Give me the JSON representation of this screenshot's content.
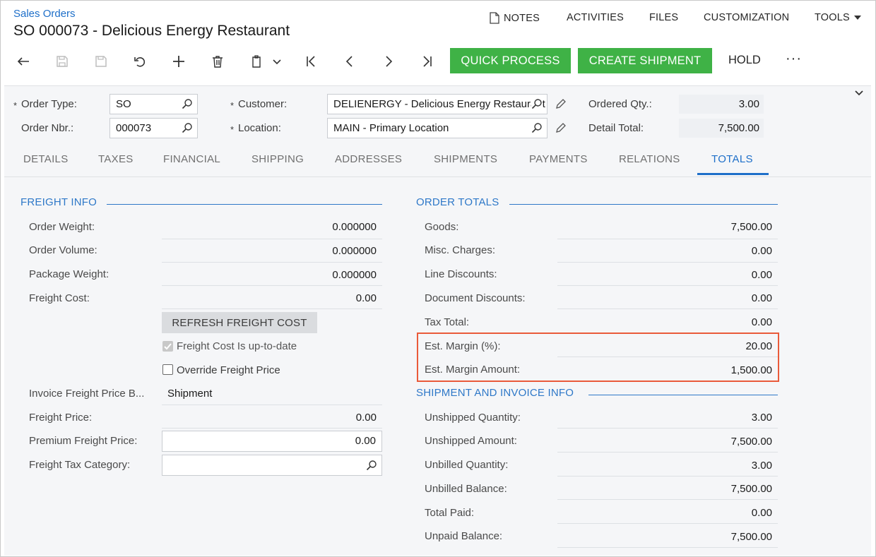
{
  "header": {
    "breadcrumb": "Sales Orders",
    "title": "SO 000073 - Delicious Energy Restaurant",
    "nav": {
      "notes": "NOTES",
      "activities": "ACTIVITIES",
      "files": "FILES",
      "customization": "CUSTOMIZATION",
      "tools": "TOOLS"
    }
  },
  "toolbar": {
    "quick_process": "QUICK PROCESS",
    "create_shipment": "CREATE SHIPMENT",
    "hold": "HOLD",
    "more": "···"
  },
  "summary": {
    "order_type_label": "Order Type:",
    "order_type": "SO",
    "order_nbr_label": "Order Nbr.:",
    "order_nbr": "000073",
    "customer_label": "Customer:",
    "customer": "DELIENERGY - Delicious Energy Restaurant",
    "location_label": "Location:",
    "location": "MAIN - Primary Location",
    "ordered_qty_label": "Ordered Qty.:",
    "ordered_qty": "3.00",
    "detail_total_label": "Detail Total:",
    "detail_total": "7,500.00",
    "required_mark": "*"
  },
  "tabs": [
    "DETAILS",
    "TAXES",
    "FINANCIAL",
    "SHIPPING",
    "ADDRESSES",
    "SHIPMENTS",
    "PAYMENTS",
    "RELATIONS",
    "TOTALS"
  ],
  "freight": {
    "title": "FREIGHT INFO",
    "order_weight_label": "Order Weight:",
    "order_weight": "0.000000",
    "order_volume_label": "Order Volume:",
    "order_volume": "0.000000",
    "package_weight_label": "Package Weight:",
    "package_weight": "0.000000",
    "freight_cost_label": "Freight Cost:",
    "freight_cost": "0.00",
    "refresh_button": "REFRESH FREIGHT COST",
    "up_to_date_label": "Freight Cost Is up-to-date",
    "override_label": "Override Freight Price",
    "invoice_basis_label": "Invoice Freight Price B...",
    "invoice_basis": "Shipment",
    "freight_price_label": "Freight Price:",
    "freight_price": "0.00",
    "premium_label": "Premium Freight Price:",
    "premium": "0.00",
    "tax_category_label": "Freight Tax Category:",
    "tax_category": ""
  },
  "totals": {
    "title": "ORDER TOTALS",
    "goods_label": "Goods:",
    "goods": "7,500.00",
    "misc_label": "Misc. Charges:",
    "misc": "0.00",
    "line_disc_label": "Line Discounts:",
    "line_disc": "0.00",
    "doc_disc_label": "Document Discounts:",
    "doc_disc": "0.00",
    "tax_total_label": "Tax Total:",
    "tax_total": "0.00",
    "margin_pct_label": "Est. Margin (%):",
    "margin_pct": "20.00",
    "margin_amt_label": "Est. Margin Amount:",
    "margin_amt": "1,500.00"
  },
  "shipment_info": {
    "title": "SHIPMENT AND INVOICE INFO",
    "unshipped_qty_label": "Unshipped Quantity:",
    "unshipped_qty": "3.00",
    "unshipped_amt_label": "Unshipped Amount:",
    "unshipped_amt": "7,500.00",
    "unbilled_qty_label": "Unbilled Quantity:",
    "unbilled_qty": "3.00",
    "unbilled_bal_label": "Unbilled Balance:",
    "unbilled_bal": "7,500.00",
    "total_paid_label": "Total Paid:",
    "total_paid": "0.00",
    "unpaid_bal_label": "Unpaid Balance:",
    "unpaid_bal": "7,500.00"
  },
  "colors": {
    "accent": "#1e6fc9",
    "green": "#3fb246",
    "highlight": "#ea5a3a"
  }
}
